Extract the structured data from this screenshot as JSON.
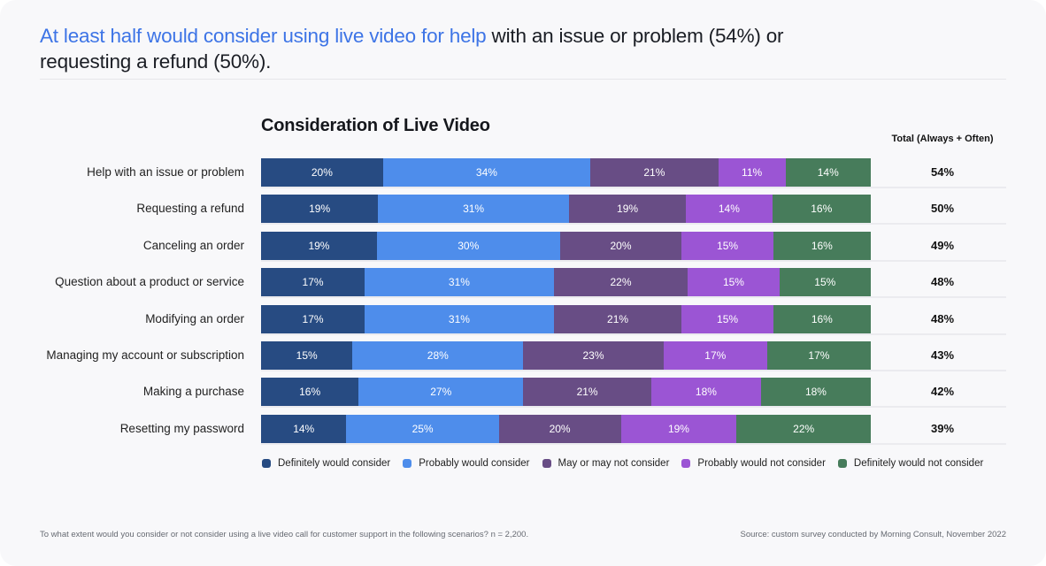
{
  "headline": {
    "highlight": "At least half would consider using live video for help",
    "rest": " with an issue or problem (54%) or requesting a refund (50%)."
  },
  "chart_data": {
    "type": "bar",
    "orientation": "horizontal",
    "stacked": "percent",
    "title": "Consideration of Live Video",
    "total_header": "Total (Always + Often)",
    "categories": [
      "Help with an issue or problem",
      "Requesting a refund",
      "Canceling an order",
      "Question about a product or service",
      "Modifying an order",
      "Managing my account or subscription",
      "Making a purchase",
      "Resetting my password"
    ],
    "series": [
      {
        "name": "Definitely would consider",
        "color": "#274b82",
        "values": [
          20,
          19,
          19,
          17,
          17,
          15,
          16,
          14
        ]
      },
      {
        "name": "Probably would consider",
        "color": "#4e8deb",
        "values": [
          34,
          31,
          30,
          31,
          31,
          28,
          27,
          25
        ]
      },
      {
        "name": "May or may not consider",
        "color": "#684d85",
        "values": [
          21,
          19,
          20,
          22,
          21,
          23,
          21,
          20
        ]
      },
      {
        "name": "Probably would not consider",
        "color": "#9b55d4",
        "values": [
          11,
          14,
          15,
          15,
          15,
          17,
          18,
          19
        ]
      },
      {
        "name": "Definitely would not consider",
        "color": "#477c5b",
        "values": [
          14,
          16,
          16,
          15,
          16,
          17,
          18,
          22
        ]
      }
    ],
    "totals": [
      "54%",
      "50%",
      "49%",
      "48%",
      "48%",
      "43%",
      "42%",
      "39%"
    ],
    "value_suffix": "%",
    "legend_position": "bottom",
    "grid": false
  },
  "footer": {
    "question": "To what extent would you consider or not consider using a live video call for customer support in the following scenarios? n = 2,200.",
    "source": "Source: custom survey conducted by Morning Consult, November 2022"
  }
}
